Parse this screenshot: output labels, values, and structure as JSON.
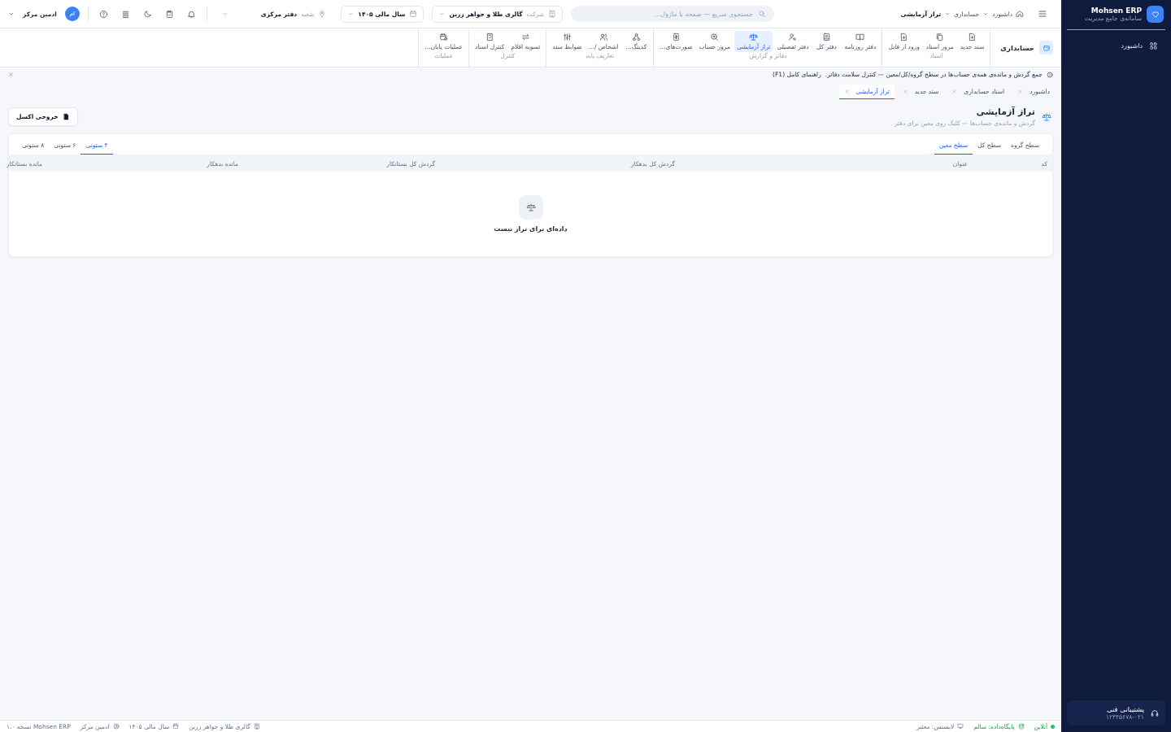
{
  "sidebar": {
    "brand": "Mohsen ERP",
    "tagline": "سامانه‌ی جامع مدیریت",
    "items": [
      {
        "label": "داشبورد",
        "selected": false
      }
    ],
    "support": {
      "title": "پشتیبانی فنی",
      "phone": "۱۲۳۴۵۶۷۸-۰۲۱"
    }
  },
  "topbar": {
    "breadcrumb": [
      "داشبورد",
      "حسابداری",
      "تراز آزمایشی"
    ],
    "search": {
      "placeholder": "جستجوی سریع — صفحه یا ماژول..."
    },
    "company": {
      "label": "شرکت",
      "value": "گالری طلا و جواهر زرین"
    },
    "year": {
      "value": "سال مالی ۱۴۰۵"
    },
    "branch": {
      "label": "شعبه",
      "value": "دفتر مرکزی"
    },
    "user": {
      "initials": "ام",
      "name": "ادمین مرکز"
    }
  },
  "ribbon": {
    "title": "حسابداری",
    "groups": [
      {
        "name": "اسناد",
        "items": [
          {
            "label": "سند جدید",
            "selected": false
          },
          {
            "label": "مرور اسناد",
            "selected": false
          },
          {
            "label": "ورود از فایل",
            "selected": false
          }
        ]
      },
      {
        "name": "دفاتر و گزارش",
        "items": [
          {
            "label": "دفتر روزنامه",
            "selected": false
          },
          {
            "label": "دفتر کل",
            "selected": false
          },
          {
            "label": "دفتر تفصیلی",
            "selected": false
          },
          {
            "label": "تراز آزمایشی",
            "selected": true
          },
          {
            "label": "مرور حساب",
            "selected": false
          },
          {
            "label": "صورت‌های...",
            "selected": false
          }
        ]
      },
      {
        "name": "تعاریف پایه",
        "items": [
          {
            "label": "کدینگ...",
            "selected": false
          },
          {
            "label": "اشخاص /...",
            "selected": false
          },
          {
            "label": "ضوابط سند",
            "selected": false
          }
        ]
      },
      {
        "name": "کنترل",
        "items": [
          {
            "label": "تسویه اقلام",
            "selected": false
          },
          {
            "label": "کنترل اسناد",
            "selected": false
          }
        ]
      },
      {
        "name": "عملیات",
        "items": [
          {
            "label": "عملیات پایان...",
            "selected": false
          }
        ]
      }
    ]
  },
  "info_bar": {
    "text": "جمع گردش و مانده‌ی همه‌ی حساب‌ها در سطح گروه/کل/معین — کنترل سلامت دفاتر.",
    "link": "راهنمای کامل (F1)"
  },
  "tabs": [
    {
      "label": "داشبورد",
      "selected": false
    },
    {
      "label": "اسناد حسابداری",
      "selected": false
    },
    {
      "label": "سند جدید",
      "selected": false
    },
    {
      "label": "تراز آزمایشی",
      "selected": true
    }
  ],
  "page": {
    "title": "تراز آزمایشی",
    "subtitle": "گردش و مانده‌ی حساب‌ها — کلیک روی معین برای دفتر",
    "export_button": "خروجی اکسل"
  },
  "level_tabs": [
    {
      "label": "سطح گروه",
      "selected": false
    },
    {
      "label": "سطح کل",
      "selected": false
    },
    {
      "label": "سطح معین",
      "selected": true
    }
  ],
  "column_tabs": [
    {
      "label": "۴ ستونی",
      "selected": true
    },
    {
      "label": "۶ ستونی",
      "selected": false
    },
    {
      "label": "۸ ستونی",
      "selected": false
    }
  ],
  "table": {
    "columns": [
      "کد",
      "عنوان",
      "گردش کل بدهکار",
      "گردش کل بستانکار",
      "مانده بدهکار",
      "مانده بستانکار"
    ],
    "empty_text": "داده‌ای برای تراز نیست"
  },
  "status_bar": {
    "online": "آنلاین",
    "database": "پایگاه‌داده: سالم",
    "license": "لایسنس: معتبر",
    "company": "گالری طلا و جواهر زرین",
    "year": "سال مالی ۱۴۰۵",
    "user": "ادمین مرکز",
    "version": "Mohsen ERP نسخه ۱.۰"
  }
}
